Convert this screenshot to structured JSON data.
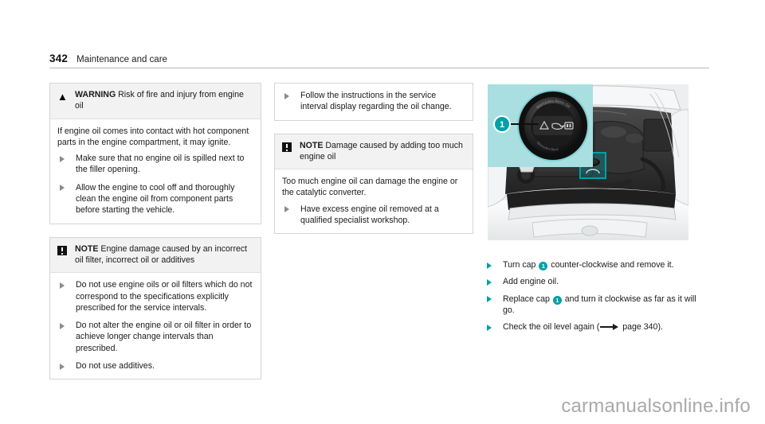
{
  "header": {
    "page_number": "342",
    "chapter": "Maintenance and care"
  },
  "column_1": {
    "warning_box": {
      "icon": "warning-triangle-icon",
      "label": "WARNING",
      "title": " Risk of fire and injury from engine oil",
      "intro": "If engine oil comes into contact with hot component parts in the engine compartment, it may ignite.",
      "steps": [
        "Make sure that no engine oil is spilled next to the filler opening.",
        "Allow the engine to cool off and thoroughly clean the engine oil from component parts before starting the vehicle."
      ]
    },
    "note_box": {
      "icon": "note-exclamation-icon",
      "label": "NOTE",
      "title": " Engine damage caused by an incorrect oil filter, incorrect oil or additives",
      "steps": [
        "Do not use engine oils or oil filters which do not correspond to the specifications explicitly prescribed for the service intervals.",
        "Do not alter the engine oil or oil filter in order to achieve longer change intervals than prescribed.",
        "Do not use additives."
      ]
    }
  },
  "column_2": {
    "continuation_box": {
      "steps": [
        "Follow the instructions in the service interval display regarding the oil change."
      ]
    },
    "note_box": {
      "icon": "note-exclamation-icon",
      "label": "NOTE",
      "title": " Damage caused by adding too much engine oil",
      "intro": "Too much engine oil can damage the engine or the catalytic converter.",
      "steps": [
        "Have excess engine oil removed at a qualified specialist workshop."
      ]
    }
  },
  "column_3": {
    "figure": {
      "name": "engine-compartment-oil-filler-cap-illustration",
      "callout_number": "1",
      "cap_text": "Mercedes-Benz Oil",
      "inset_background": "#a9dfe0",
      "accent_color": "#00a0a8"
    },
    "steps": [
      {
        "before": "Turn cap ",
        "badge": "1",
        "after": " counter-clockwise and remove it."
      },
      {
        "before": "Add engine oil.",
        "badge": "",
        "after": ""
      },
      {
        "before": "Replace cap ",
        "badge": "1",
        "after": " and turn it clockwise as far as it will go."
      },
      {
        "before": "Check the oil level again (",
        "badge": "",
        "after": " page 340)."
      }
    ],
    "cross_reference_page": " page 340)."
  },
  "watermark": "carmanualsonline.info"
}
